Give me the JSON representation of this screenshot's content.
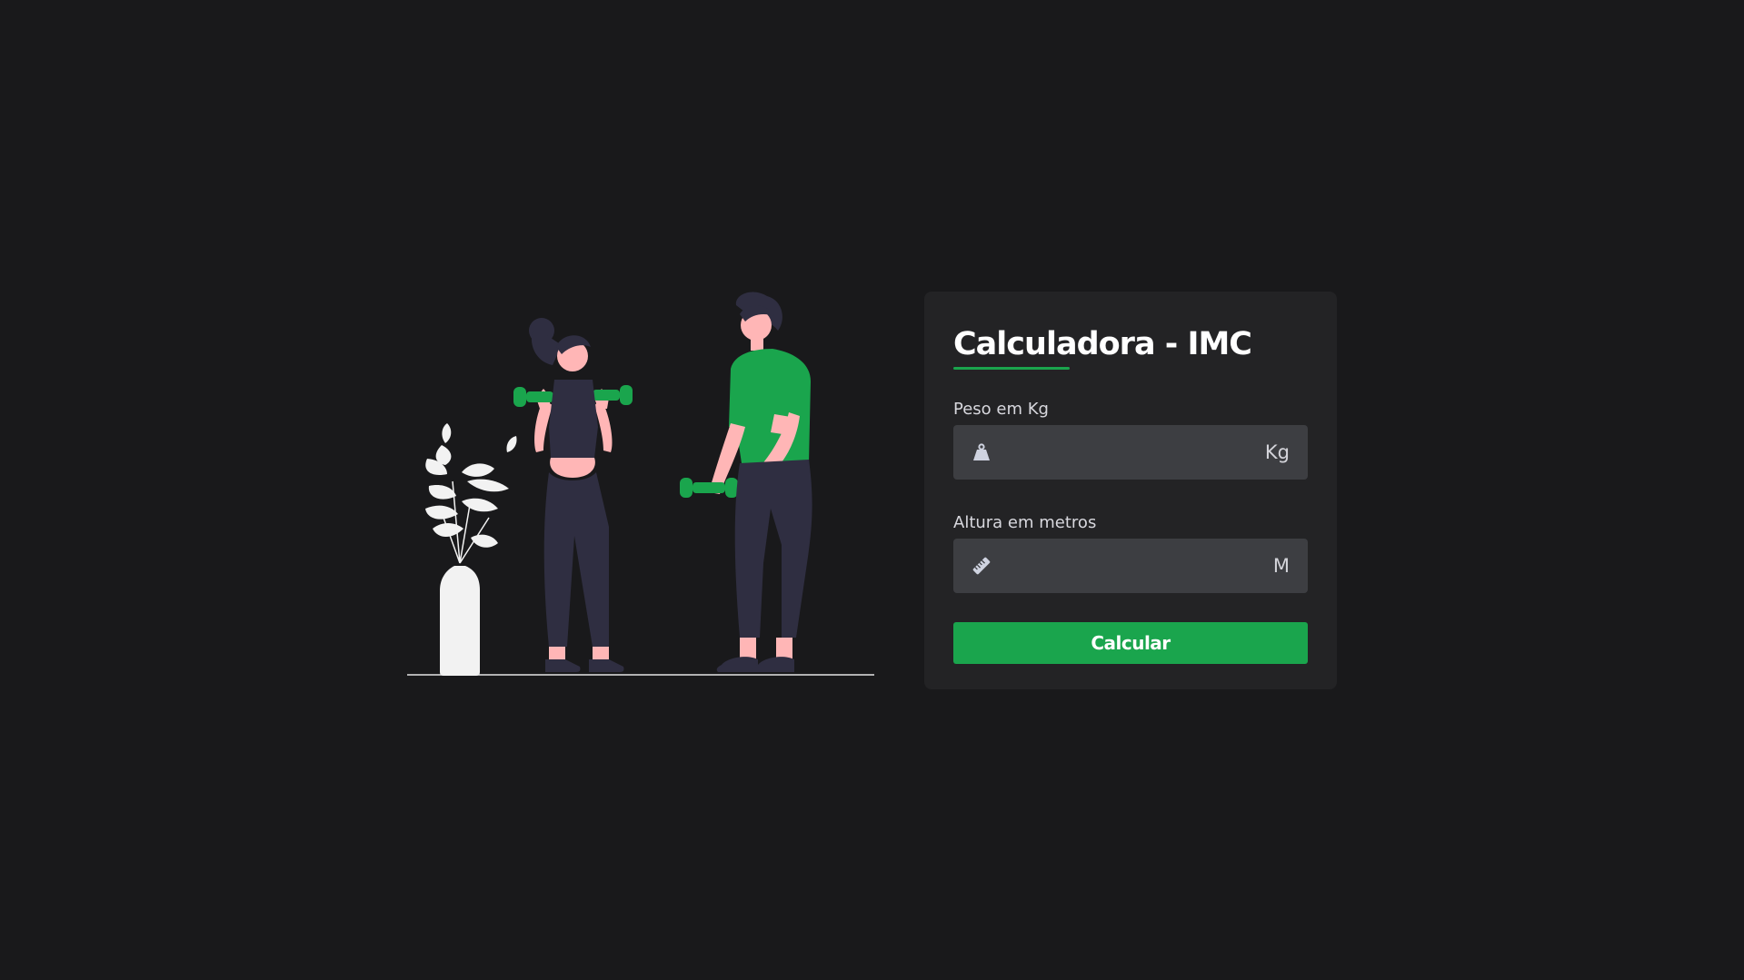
{
  "form": {
    "title": "Calculadora - IMC",
    "weight": {
      "label": "Peso em Kg",
      "value": "",
      "placeholder": "",
      "unit": "Kg",
      "icon": "weight-icon"
    },
    "height": {
      "label": "Altura em metros",
      "value": "",
      "placeholder": "",
      "unit": "M",
      "icon": "ruler-icon"
    },
    "submit_label": "Calcular"
  },
  "colors": {
    "background": "#19191b",
    "card": "#232325",
    "input": "#3d3e42",
    "accent": "#1aa54d",
    "text": "#ffffff"
  }
}
